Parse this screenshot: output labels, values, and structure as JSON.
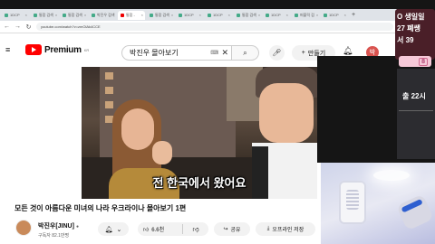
{
  "browser": {
    "tabs": [
      {
        "label": "1DCP",
        "active": false
      },
      {
        "label": "통합 검색",
        "active": false
      },
      {
        "label": "통합 검색",
        "active": false
      },
      {
        "label": "박진우 검색",
        "active": false
      },
      {
        "label": "통합 -",
        "active": true
      },
      {
        "label": "통합 검색",
        "active": false
      },
      {
        "label": "1DCP",
        "active": false
      },
      {
        "label": "1DCP",
        "active": false
      },
      {
        "label": "통합 검색",
        "active": false
      },
      {
        "label": "1DCP",
        "active": false
      },
      {
        "label": "퍼블릭 검",
        "active": false
      },
      {
        "label": "1DCP",
        "active": false
      }
    ],
    "new_tab": "+",
    "url": "youtube.com/watch?v=zmOlAk4CCE"
  },
  "youtube": {
    "logo_text": "Premium",
    "logo_region": "KR",
    "search_value": "박진우 몰아보기",
    "create_label": "만들기",
    "avatar_letter": "박"
  },
  "video": {
    "subtitle": "전 한국에서 왔어요"
  },
  "watch": {
    "title": "모든 것이 아름다운 미녀의 나라 우크라이나 몰아보기 1편",
    "channel_name": "박진우[JINU]",
    "subscribers": "구독자 82.1만명",
    "likes": "6.6천",
    "share_label": "공유",
    "offline_label": "오프라인 저장"
  },
  "overlay": {
    "lines": [
      "O 생일일",
      "27 폐쌩",
      "서 39"
    ],
    "pink_badge": "8",
    "time_text": "출 22시"
  },
  "colors": {
    "brand_red": "#ff0000",
    "overlay_bg": "#4a1f28",
    "pink": "#f6c9d8"
  }
}
